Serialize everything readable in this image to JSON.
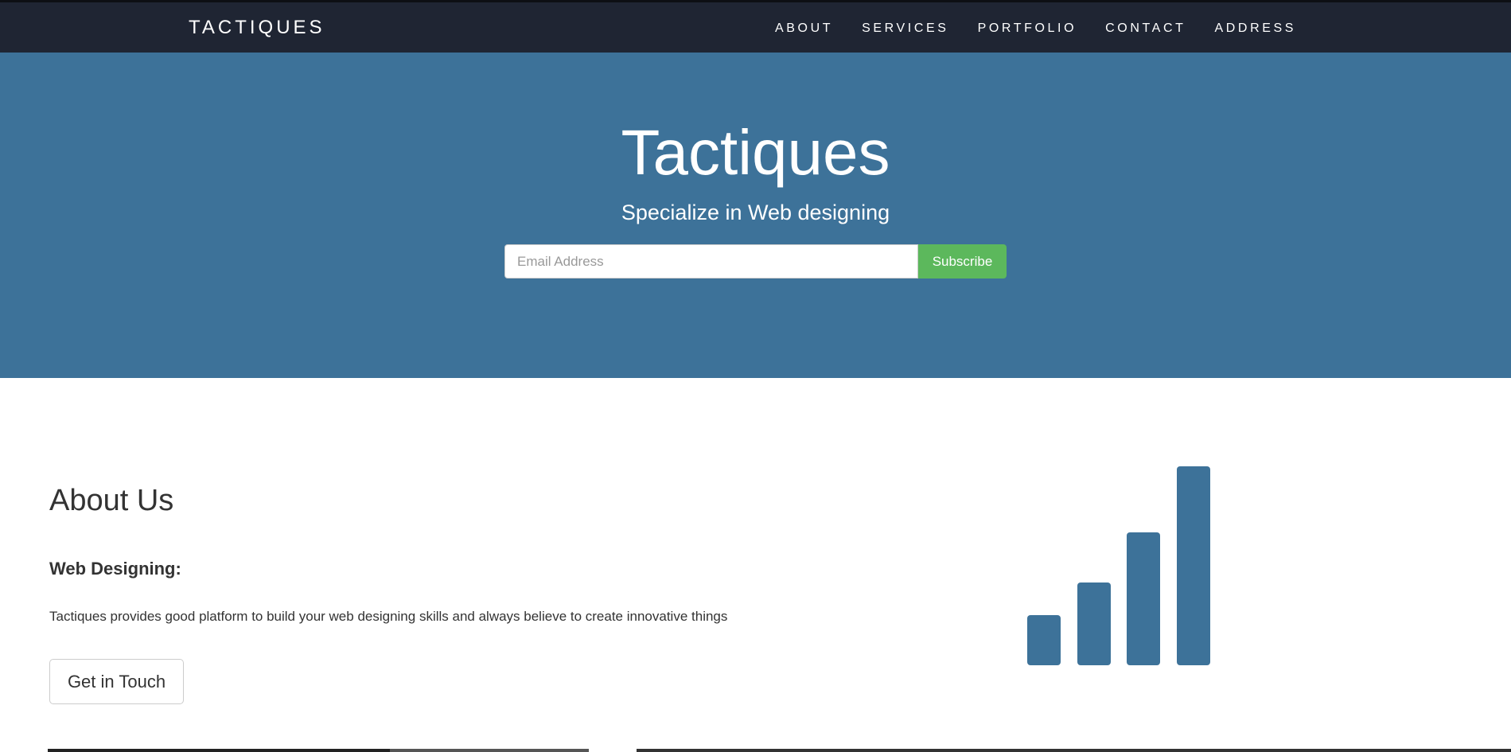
{
  "navbar": {
    "brand": "TACTIQUES",
    "links": [
      "ABOUT",
      "SERVICES",
      "PORTFOLIO",
      "CONTACT",
      "ADDRESS"
    ]
  },
  "hero": {
    "title": "Tactiques",
    "subtitle": "Specialize in Web designing",
    "email_placeholder": "Email Address",
    "email_value": "",
    "subscribe_label": "Subscribe"
  },
  "about": {
    "title": "About Us",
    "heading": "Web Designing:",
    "text": "Tactiques provides good platform to build your web designing skills and always believe to create innovative things",
    "button_label": "Get in Touch",
    "icon": "signal-bars-icon"
  },
  "colors": {
    "navbar_bg": "#1f2533",
    "hero_bg": "#3d7299",
    "subscribe_bg": "#5cb85c",
    "icon_color": "#3d7299"
  }
}
